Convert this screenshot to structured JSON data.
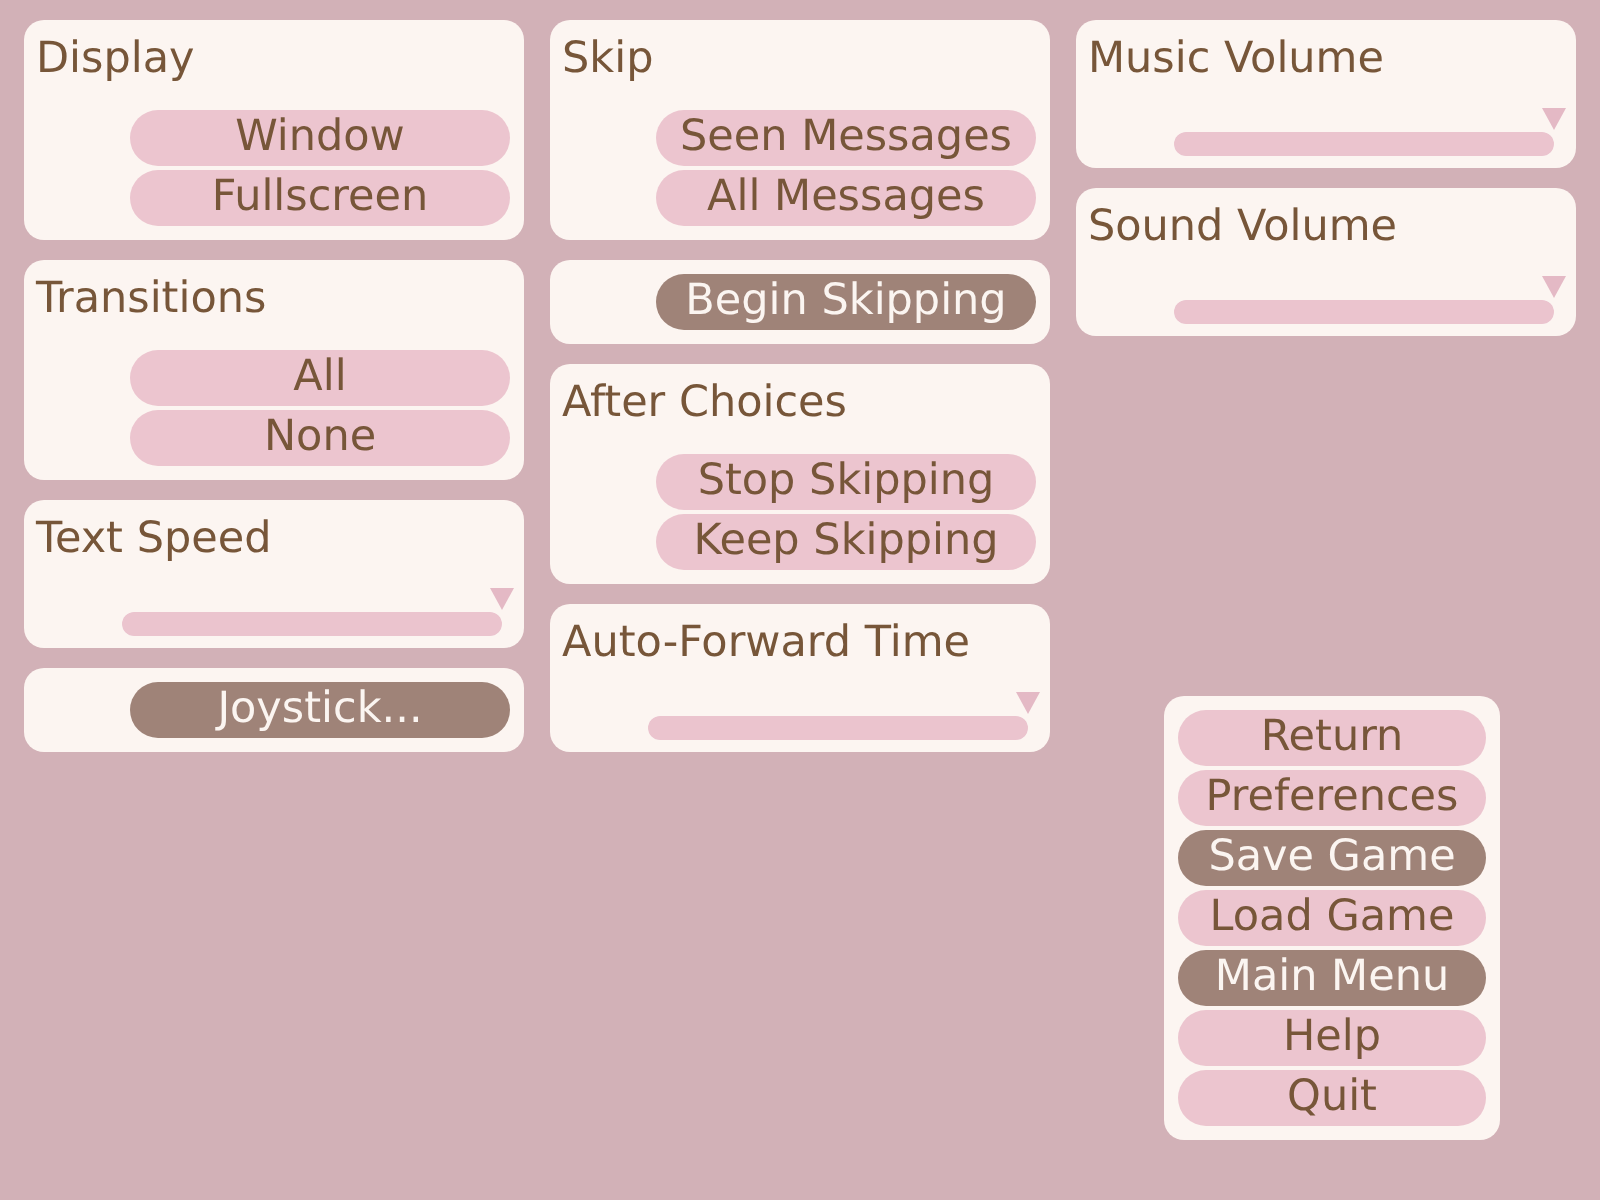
{
  "columns": [
    {
      "panels": [
        {
          "kind": "buttons",
          "title": "Display",
          "buttons": [
            {
              "label": "Window",
              "disabled": false
            },
            {
              "label": "Fullscreen",
              "disabled": false
            }
          ]
        },
        {
          "kind": "buttons",
          "title": "Transitions",
          "buttons": [
            {
              "label": "All",
              "disabled": false
            },
            {
              "label": "None",
              "disabled": false
            }
          ]
        },
        {
          "kind": "slider",
          "title": "Text Speed",
          "level": 1
        },
        {
          "kind": "buttons",
          "buttons": [
            {
              "label": "Joystick...",
              "disabled": true
            }
          ]
        }
      ]
    },
    {
      "panels": [
        {
          "kind": "buttons",
          "title": "Skip",
          "buttons": [
            {
              "label": "Seen Messages",
              "disabled": false
            },
            {
              "label": "All Messages",
              "disabled": false
            }
          ]
        },
        {
          "kind": "buttons",
          "buttons": [
            {
              "label": "Begin Skipping",
              "disabled": true
            }
          ]
        },
        {
          "kind": "buttons",
          "title": "After Choices",
          "buttons": [
            {
              "label": "Stop Skipping",
              "disabled": false
            },
            {
              "label": "Keep Skipping",
              "disabled": false
            }
          ]
        },
        {
          "kind": "slider",
          "title": "Auto-Forward Time",
          "level": 1
        }
      ]
    },
    {
      "panels": [
        {
          "kind": "slider",
          "title": "Music Volume",
          "level": 1
        },
        {
          "kind": "slider",
          "title": "Sound Volume",
          "level": 1
        }
      ]
    }
  ],
  "menu": {
    "buttons": [
      {
        "label": "Return",
        "disabled": false
      },
      {
        "label": "Preferences",
        "disabled": false
      },
      {
        "label": "Save Game",
        "disabled": true
      },
      {
        "label": "Load Game",
        "disabled": false
      },
      {
        "label": "Main Menu",
        "disabled": true
      },
      {
        "label": "Help",
        "disabled": false
      },
      {
        "label": "Quit",
        "disabled": false
      }
    ]
  }
}
